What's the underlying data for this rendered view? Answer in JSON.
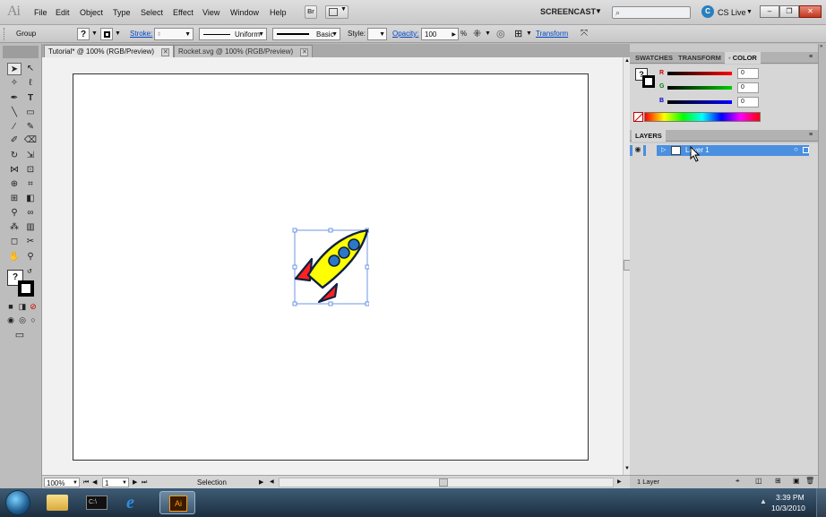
{
  "menubar": {
    "logo": "Ai",
    "items": [
      "File",
      "Edit",
      "Object",
      "Type",
      "Select",
      "Effect",
      "View",
      "Window",
      "Help"
    ],
    "bridge_label": "Br",
    "workspace": "SCREENCAST",
    "cs_live": "CS Live"
  },
  "controlbar": {
    "selection_type": "Group",
    "fill_value": "?",
    "stroke_label": "Stroke:",
    "profile_label": "Uniform",
    "brush_label": "Basic",
    "style_label": "Style:",
    "opacity_label": "Opacity:",
    "opacity_value": "100",
    "opacity_unit": "%",
    "transform_label": "Transform"
  },
  "tabs": [
    {
      "label": "Tutorial* @ 100% (RGB/Preview)",
      "active": true
    },
    {
      "label": "Rocket.svg @ 100% (RGB/Preview)",
      "active": false
    }
  ],
  "color_panel": {
    "tabs": [
      "SWATCHES",
      "TRANSFORM",
      "COLOR"
    ],
    "active_tab": "COLOR",
    "fill_icon": "?",
    "channels": [
      {
        "label": "R",
        "value": "0",
        "color": "#ff0000"
      },
      {
        "label": "G",
        "value": "0",
        "color": "#00cc00"
      },
      {
        "label": "B",
        "value": "0",
        "color": "#0000ff"
      }
    ]
  },
  "layers_panel": {
    "title": "LAYERS",
    "layers": [
      {
        "name": "Layer 1"
      }
    ],
    "count_label": "1 Layer"
  },
  "statusbar": {
    "zoom": "100%",
    "artboard": "1",
    "tool": "Selection"
  },
  "taskbar": {
    "time": "3:39 PM",
    "date": "10/3/2010"
  },
  "colors": {
    "selection_blue": "#4a8fe0",
    "rocket_body": "#ffff00",
    "rocket_fins": "#ff2020",
    "rocket_windows": "#2b78c8"
  }
}
